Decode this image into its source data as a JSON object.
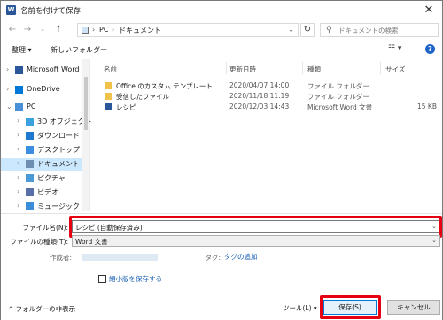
{
  "window": {
    "title": "名前を付けて保存",
    "close_label": "✕"
  },
  "address": {
    "segments": [
      "PC",
      "ドキュメント"
    ],
    "search_placeholder": "ドキュメントの検索"
  },
  "toolbar": {
    "organize": "整理 ▾",
    "new_folder": "新しいフォルダー"
  },
  "nav": {
    "items": [
      {
        "label": "Microsoft Word",
        "chevron": "›",
        "icon": "word-icon",
        "color": "#2b579a"
      },
      {
        "label": "OneDrive",
        "chevron": "›",
        "icon": "cloud-icon",
        "color": "#0078d7"
      },
      {
        "label": "PC",
        "chevron": "⌄",
        "icon": "pc-icon",
        "color": "#4a90d9"
      },
      {
        "label": "3D オブジェクト",
        "chevron": "›",
        "icon": "cube-icon",
        "color": "#3aa0e0"
      },
      {
        "label": "ダウンロード",
        "chevron": "›",
        "icon": "download-icon",
        "color": "#1e78d0"
      },
      {
        "label": "デスクトップ",
        "chevron": "›",
        "icon": "desktop-icon",
        "color": "#3a8fe0"
      },
      {
        "label": "ドキュメント",
        "chevron": "›",
        "icon": "documents-icon",
        "color": "#6f8fb0",
        "selected": true
      },
      {
        "label": "ピクチャ",
        "chevron": "›",
        "icon": "pictures-icon",
        "color": "#4a9ad8"
      },
      {
        "label": "ビデオ",
        "chevron": "›",
        "icon": "video-icon",
        "color": "#5a6fa8"
      },
      {
        "label": "ミュージック",
        "chevron": "›",
        "icon": "music-icon",
        "color": "#3a8fd8"
      }
    ]
  },
  "files": {
    "columns": [
      "名前",
      "更新日時",
      "種類",
      "サイズ"
    ],
    "rows": [
      {
        "name": "Office のカスタム テンプレート",
        "date": "2020/04/07 14:00",
        "type": "ファイル フォルダー",
        "size": "",
        "icon": "folder-icon"
      },
      {
        "name": "受信したファイル",
        "date": "2020/11/18 11:19",
        "type": "ファイル フォルダー",
        "size": "",
        "icon": "folder-icon"
      },
      {
        "name": "レシピ",
        "date": "2020/12/03 14:43",
        "type": "Microsoft Word 文書",
        "size": "15 KB",
        "icon": "word-doc-icon"
      }
    ]
  },
  "form": {
    "filename_label": "ファイル名(N):",
    "filename_value": "レシピ (自動保存済み)",
    "filetype_label": "ファイルの種類(T):",
    "filetype_value": "Word 文書",
    "author_label": "作成者:",
    "tags_label": "タグ:",
    "tags_link": "タグの追加",
    "thumbnail_label": "縮小版を保存する",
    "thumbnail_checked": false
  },
  "footer": {
    "hide_folders": "フォルダーの非表示",
    "tools": "ツール(L)",
    "save": "保存(S)",
    "cancel": "キャンセル"
  },
  "colors": {
    "highlight": "#e60012",
    "selection": "#cce8ff",
    "link": "#1a5fb4",
    "accent": "#0078d7"
  }
}
